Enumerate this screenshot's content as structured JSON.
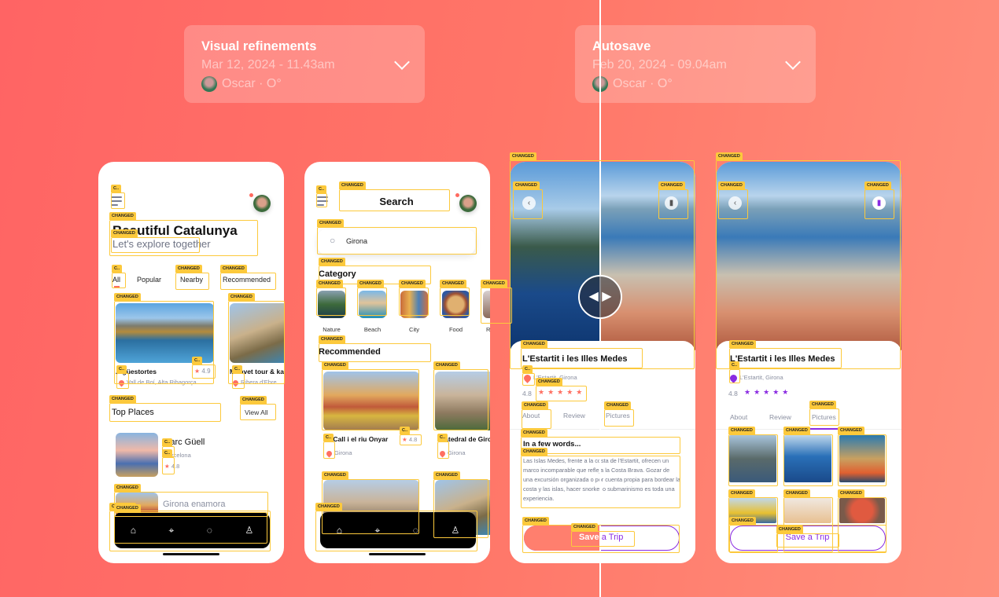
{
  "versions": [
    {
      "title": "Visual refinements",
      "date": "Mar 12, 2024 - 11.43am",
      "author": "Oscar · O°"
    },
    {
      "title": "Autosave",
      "date": "Feb 20, 2024 - 09.04am",
      "author": "Oscar · O°"
    }
  ],
  "annotation_labels": {
    "full": "CHANGED",
    "short": "C.."
  },
  "colors": {
    "accent_old": "#ff7f6e",
    "accent_new": "#8a2be2",
    "annotation": "#fcc93c"
  },
  "home": {
    "title": "Beautiful Catalunya",
    "subtitle": "Let's explore together",
    "tabs": [
      "All",
      "Popular",
      "Nearby",
      "Recommended"
    ],
    "cards": [
      {
        "title": "Aigüestortes",
        "rating": "4.9",
        "location": "Vall de Boí, Alta Ribagorça"
      },
      {
        "title": "Miravet tour & kayak",
        "location": "Ribera d'Ebre"
      }
    ],
    "top_places": "Top Places",
    "view_all": "View All",
    "places": [
      {
        "title": "Parc Güell",
        "location": "Barcelona",
        "rating": "4.8"
      },
      {
        "title": "Girona enamora"
      }
    ]
  },
  "search": {
    "title": "Search",
    "query": "Girona",
    "category": "Category",
    "categories": [
      "Nature",
      "Beach",
      "City",
      "Food",
      "R"
    ],
    "recommended": "Recommended",
    "cards": [
      {
        "title": "El Call i el riu Onyar",
        "rating": "4.8",
        "location": "Girona"
      },
      {
        "title": "Catedral de Girona",
        "location": "Girona"
      }
    ]
  },
  "detail": {
    "title": "L'Estartit i les Illes Medes",
    "location": "L'Estartit, Girona",
    "rating": "4.8",
    "stars": 5,
    "tabs": [
      "About",
      "Review",
      "Pictures"
    ],
    "section_title": "In a few words...",
    "body": "Las Islas Medes, frente a la costa de l'Estartit, ofrecen un marco incomparable que refleja la Costa Brava. Gozar de una excursión organizada o por cuenta propia para bordear la costa y las islas, hacer snorkel o submarinismo es toda una experiencia.",
    "save": "Save a Trip"
  },
  "nav_icons": [
    "home-icon",
    "map-pin-icon",
    "chat-icon",
    "profile-icon"
  ],
  "star_glyph": "★"
}
